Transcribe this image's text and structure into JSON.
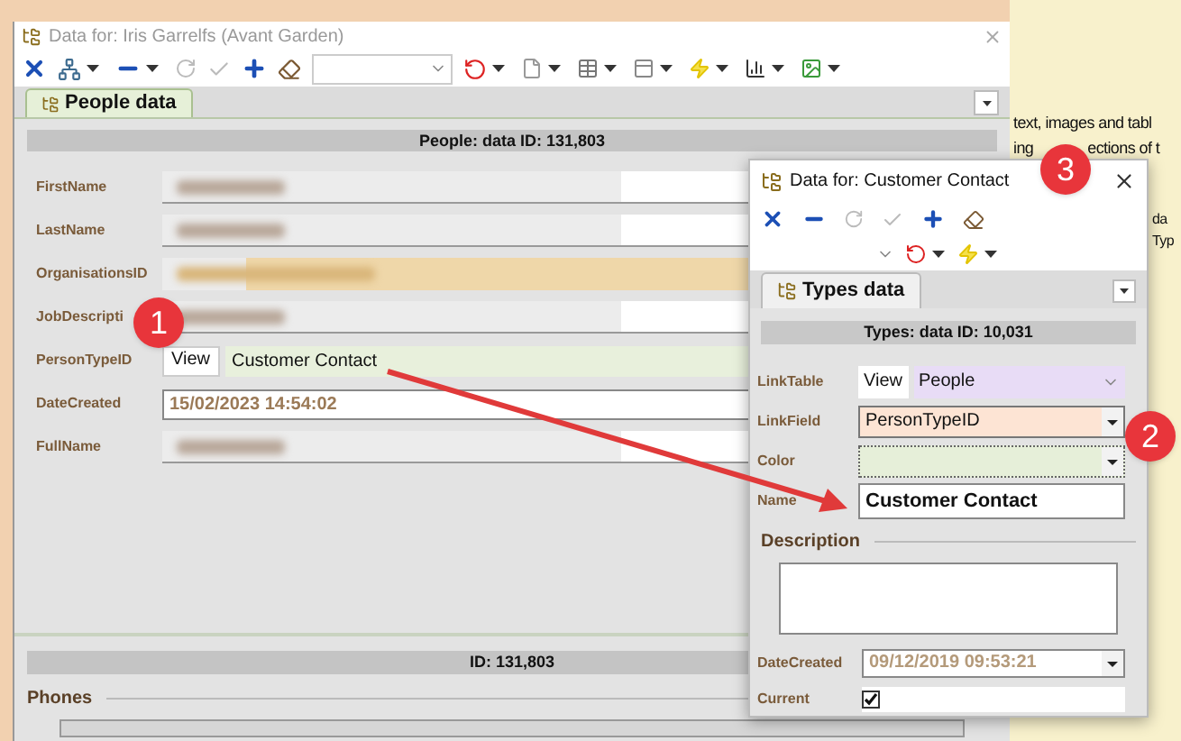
{
  "main_window": {
    "title": "Data for: Iris Garrelfs (Avant Garden)",
    "tab": {
      "label": "People data",
      "selected": true
    },
    "header": "People: data ID: 131,803",
    "fields": [
      {
        "label": "FirstName",
        "kind": "redacted"
      },
      {
        "label": "LastName",
        "kind": "redacted"
      },
      {
        "label": "OrganisationsID",
        "kind": "redacted_lookup"
      },
      {
        "label": "JobDescripti",
        "kind": "redacted"
      },
      {
        "label": "PersonTypeID",
        "kind": "lookup",
        "button": "View",
        "value": "Customer Contact",
        "color": "#e8f0dc"
      },
      {
        "label": "DateCreated",
        "kind": "date",
        "value": "15/02/2023 14:54:02"
      },
      {
        "label": "FullName",
        "kind": "redacted"
      }
    ],
    "footer_header": "ID: 131,803",
    "section": "Phones"
  },
  "dialog": {
    "title": "Data for: Customer Contact",
    "tab": {
      "label": "Types data",
      "selected": true
    },
    "header": "Types: data ID: 10,031",
    "fields": [
      {
        "label": "LinkTable",
        "kind": "lookup",
        "button": "View",
        "value": "People",
        "color": "#e8dcf6"
      },
      {
        "label": "LinkField",
        "kind": "combo",
        "value": "PersonTypeID",
        "color": "#fde4d4"
      },
      {
        "label": "Color",
        "kind": "color",
        "color": "#e6efd9"
      },
      {
        "label": "Name",
        "kind": "text",
        "value": "Customer Contact"
      }
    ],
    "description_label": "Description",
    "date_label": "DateCreated",
    "date_value": "09/12/2019 09:53:21",
    "current_label": "Current",
    "current_checked": true
  },
  "document": {
    "line_1": "text, images and tabl",
    "line_2_start": "ing",
    "line_2_end": "ections of t",
    "fragments": [
      "da",
      "Typ"
    ]
  },
  "badges": [
    {
      "label": "1"
    },
    {
      "label": "2"
    },
    {
      "label": "3"
    }
  ]
}
